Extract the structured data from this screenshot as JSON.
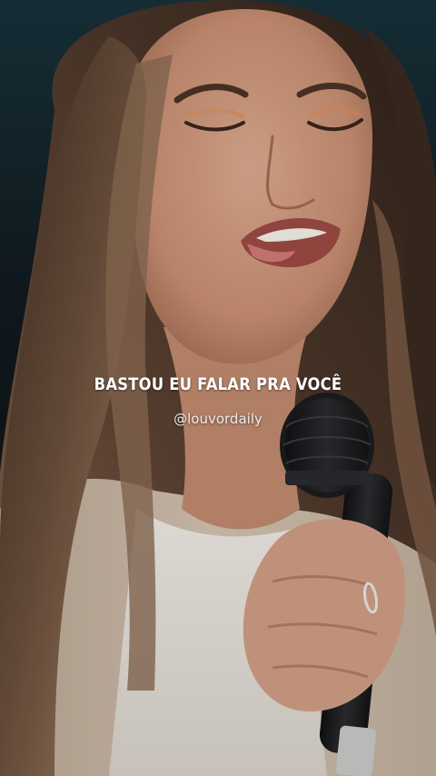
{
  "overlay": {
    "lyric_text": "BASTOU EU FALAR PRA VOCÊ",
    "watermark_handle": "@louvordaily"
  },
  "scene": {
    "subject": "woman singing into microphone, eyes closed",
    "colors": {
      "background_top": "#17313a",
      "background_dark": "#0b0b0d",
      "hair": "#4a3326",
      "hair_light": "#9a7a5e",
      "skin": "#d3a085",
      "skin_shadow": "#b07a5f",
      "shirt": "#e8e4de",
      "jacket": "#cbb9a6",
      "microphone": "#1e1f21"
    }
  }
}
